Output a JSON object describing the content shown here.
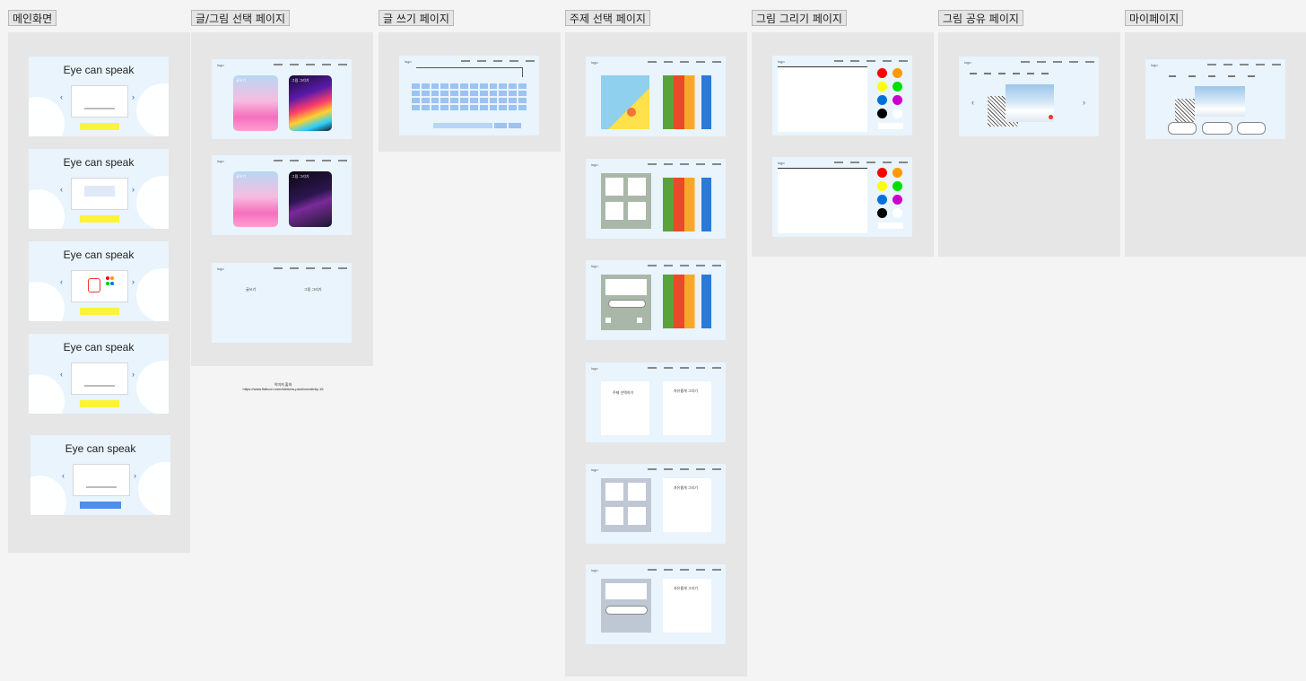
{
  "sections": {
    "main": "메인화면",
    "select": "글/그림 선택 페이지",
    "write": "글 쓰기 페이지",
    "topic": "주제 선택 페이지",
    "draw": "그림 그리기 페이지",
    "share": "그림 공유 페이지",
    "mypage": "마이페이지"
  },
  "main_frames": {
    "title": "Eye can speak"
  },
  "select_frames": {
    "logo": "logo",
    "write_option": "글쓰기",
    "draw_option": "그림 그리기"
  },
  "topic_frames": {
    "logo": "logo",
    "choose_topic": "주제 선택하기",
    "free_draw": "자유롭게 그리기"
  },
  "credit": {
    "line1": "이미지 출처",
    "line2": "https://www.flaticon.com/stickers-pack/creativity-15"
  },
  "colors": {
    "background": "#f4f4f4",
    "section": "#e6e6e6",
    "frame": "#e9f4fc",
    "yellow": "#fff23a",
    "blue": "#4a8fe8",
    "palette": [
      "#ff0000",
      "#ff9900",
      "#ffff00",
      "#00dd00",
      "#0070dd",
      "#cc00cc",
      "#000000",
      "#ffffff"
    ]
  }
}
